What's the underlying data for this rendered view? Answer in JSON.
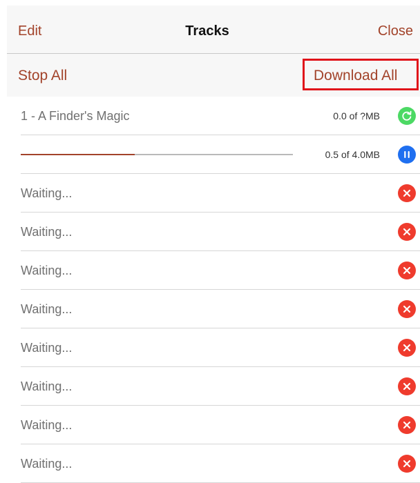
{
  "nav": {
    "edit_label": "Edit",
    "title": "Tracks",
    "close_label": "Close"
  },
  "toolbar": {
    "stop_all_label": "Stop All",
    "download_all_label": "Download All"
  },
  "tracks": [
    {
      "label": "1 - A Finder's Magic",
      "size": "0.0 of ?MB",
      "icon": "refresh-icon"
    },
    {
      "label": "",
      "size": "0.5 of 4.0MB",
      "progress": 0.42,
      "icon": "pause-icon"
    },
    {
      "label": "Waiting...",
      "icon": "cancel-icon"
    },
    {
      "label": "Waiting...",
      "icon": "cancel-icon"
    },
    {
      "label": "Waiting...",
      "icon": "cancel-icon"
    },
    {
      "label": "Waiting...",
      "icon": "cancel-icon"
    },
    {
      "label": "Waiting...",
      "icon": "cancel-icon"
    },
    {
      "label": "Waiting...",
      "icon": "cancel-icon"
    },
    {
      "label": "Waiting...",
      "icon": "cancel-icon"
    },
    {
      "label": "Waiting...",
      "icon": "cancel-icon"
    }
  ],
  "colors": {
    "accent": "#a2432a",
    "highlight_box": "#e0131a",
    "refresh": "#4cd964",
    "pause": "#1f6ff0",
    "cancel": "#ef3b2d"
  }
}
